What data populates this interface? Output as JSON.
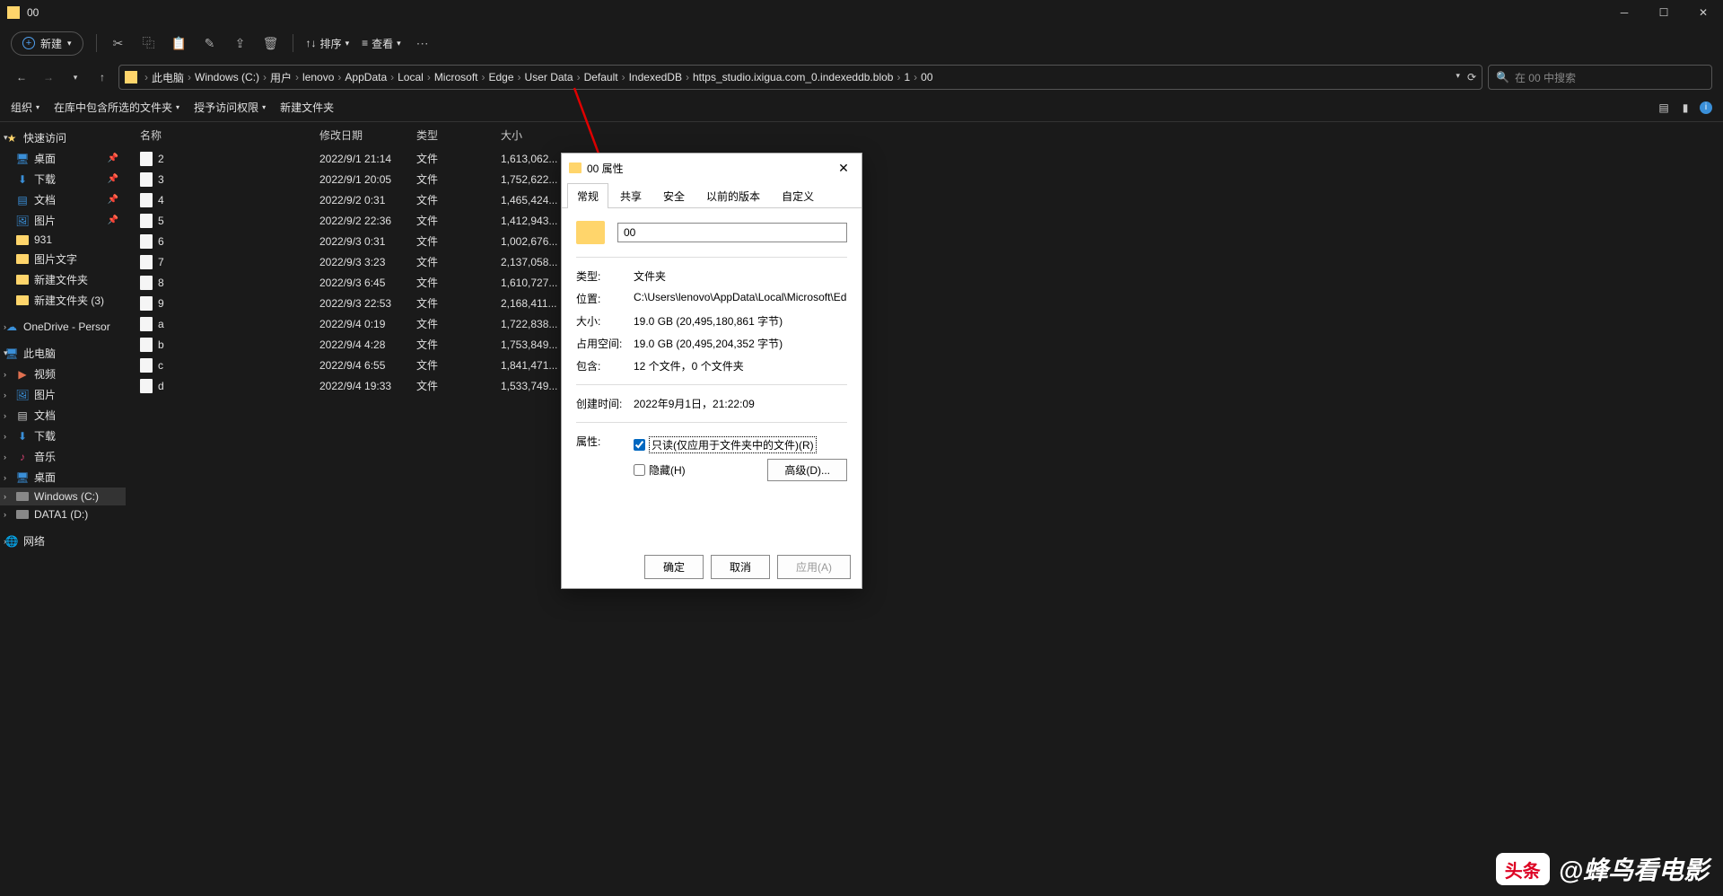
{
  "window": {
    "title": "00"
  },
  "toolbar": {
    "new": "新建",
    "sort": "排序",
    "view": "查看"
  },
  "breadcrumb": {
    "items": [
      "此电脑",
      "Windows (C:)",
      "用户",
      "lenovo",
      "AppData",
      "Local",
      "Microsoft",
      "Edge",
      "User Data",
      "Default",
      "IndexedDB",
      "https_studio.ixigua.com_0.indexeddb.blob",
      "1",
      "00"
    ]
  },
  "search": {
    "placeholder": "在 00 中搜索"
  },
  "toolstrip": {
    "org": "组织",
    "lib": "在库中包含所选的文件夹",
    "grant": "授予访问权限",
    "newfolder": "新建文件夹"
  },
  "sidebar": {
    "quick": "快速访问",
    "desktop": "桌面",
    "downloads": "下载",
    "docs": "文档",
    "pics": "图片",
    "f931": "931",
    "fpicText": "图片文字",
    "fnew": "新建文件夹",
    "fnew3": "新建文件夹 (3)",
    "onedrive": "OneDrive - Persor",
    "thispc": "此电脑",
    "videos": "视频",
    "pics2": "图片",
    "docs2": "文档",
    "downloads2": "下载",
    "music": "音乐",
    "desktop2": "桌面",
    "winc": "Windows (C:)",
    "data1": "DATA1 (D:)",
    "network": "网络"
  },
  "columns": {
    "name": "名称",
    "date": "修改日期",
    "type": "类型",
    "size": "大小"
  },
  "files": [
    {
      "name": "2",
      "date": "2022/9/1 21:14",
      "type": "文件",
      "size": "1,613,062..."
    },
    {
      "name": "3",
      "date": "2022/9/1 20:05",
      "type": "文件",
      "size": "1,752,622..."
    },
    {
      "name": "4",
      "date": "2022/9/2 0:31",
      "type": "文件",
      "size": "1,465,424..."
    },
    {
      "name": "5",
      "date": "2022/9/2 22:36",
      "type": "文件",
      "size": "1,412,943..."
    },
    {
      "name": "6",
      "date": "2022/9/3 0:31",
      "type": "文件",
      "size": "1,002,676..."
    },
    {
      "name": "7",
      "date": "2022/9/3 3:23",
      "type": "文件",
      "size": "2,137,058..."
    },
    {
      "name": "8",
      "date": "2022/9/3 6:45",
      "type": "文件",
      "size": "1,610,727..."
    },
    {
      "name": "9",
      "date": "2022/9/3 22:53",
      "type": "文件",
      "size": "2,168,411..."
    },
    {
      "name": "a",
      "date": "2022/9/4 0:19",
      "type": "文件",
      "size": "1,722,838..."
    },
    {
      "name": "b",
      "date": "2022/9/4 4:28",
      "type": "文件",
      "size": "1,753,849..."
    },
    {
      "name": "c",
      "date": "2022/9/4 6:55",
      "type": "文件",
      "size": "1,841,471..."
    },
    {
      "name": "d",
      "date": "2022/9/4 19:33",
      "type": "文件",
      "size": "1,533,749..."
    }
  ],
  "dialog": {
    "title": "00 属性",
    "tabs": [
      "常规",
      "共享",
      "安全",
      "以前的版本",
      "自定义"
    ],
    "name": "00",
    "labels": {
      "type": "类型:",
      "loc": "位置:",
      "size": "大小:",
      "disk": "占用空间:",
      "contains": "包含:",
      "created": "创建时间:",
      "attrs": "属性:"
    },
    "values": {
      "type": "文件夹",
      "loc": "C:\\Users\\lenovo\\AppData\\Local\\Microsoft\\Edge\\",
      "size": "19.0 GB (20,495,180,861 字节)",
      "disk": "19.0 GB (20,495,204,352 字节)",
      "contains": "12 个文件，0 个文件夹",
      "created": "2022年9月1日，21:22:09"
    },
    "readonly": "只读(仅应用于文件夹中的文件)(R)",
    "hidden": "隐藏(H)",
    "advanced": "高级(D)...",
    "ok": "确定",
    "cancel": "取消",
    "apply": "应用(A)"
  },
  "watermark": {
    "logo": "头条",
    "text": "@蜂鸟看电影"
  }
}
